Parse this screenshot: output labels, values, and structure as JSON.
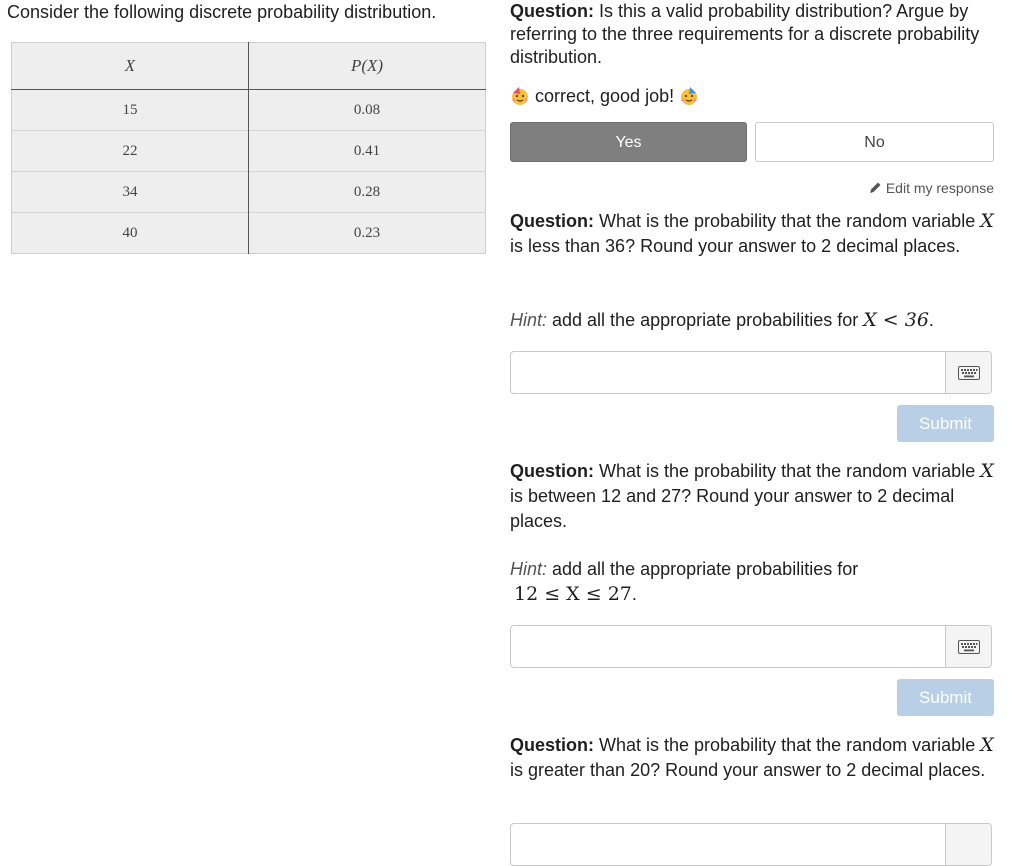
{
  "intro": "Consider the following discrete probability distribution.",
  "table": {
    "headers": [
      "X",
      "P(X)"
    ],
    "rows": [
      [
        "15",
        "0.08"
      ],
      [
        "22",
        "0.41"
      ],
      [
        "34",
        "0.28"
      ],
      [
        "40",
        "0.23"
      ]
    ]
  },
  "q1": {
    "label": "Question:",
    "text": " Is this a valid probability distribution? Argue by referring to the three requirements for a discrete probability distribution.",
    "feedback": "correct, good job!",
    "choice_yes": "Yes",
    "choice_no": "No",
    "selected": "Yes",
    "edit_label": "Edit my response"
  },
  "q2": {
    "label": "Question:",
    "text_a": " What is the probability that the random variable ",
    "var": "X",
    "text_b": " is less than 36? Round your answer to 2 decimal places.",
    "hint_label": "Hint:",
    "hint_text": " add all the appropriate probabilities for ",
    "hint_math": "X < 36",
    "hint_end": ".",
    "answer_value": "",
    "submit_label": "Submit"
  },
  "q3": {
    "label": "Question:",
    "text_a": " What is the probability that the random variable ",
    "var": "X",
    "text_b": " is between 12 and 27? Round your answer to 2 decimal places.",
    "hint_label": "Hint:",
    "hint_text": " add all the appropriate probabilities for",
    "hint_math": "12 ≤ X ≤ 27",
    "hint_end": ".",
    "answer_value": "",
    "submit_label": "Submit"
  },
  "q4": {
    "label": "Question:",
    "text_a": " What is the probability that the random variable ",
    "var": "X",
    "text_b": " is greater than 20? Round your answer to 2 decimal places."
  },
  "icons": {
    "feedback_emoji": "partying-face-icon",
    "edit": "pencil-icon",
    "keyboard": "keyboard-icon"
  },
  "colors": {
    "selected_choice": "#7f7f7f",
    "submit_disabled": "#b9cfe6",
    "table_bg": "#eeeeee"
  }
}
